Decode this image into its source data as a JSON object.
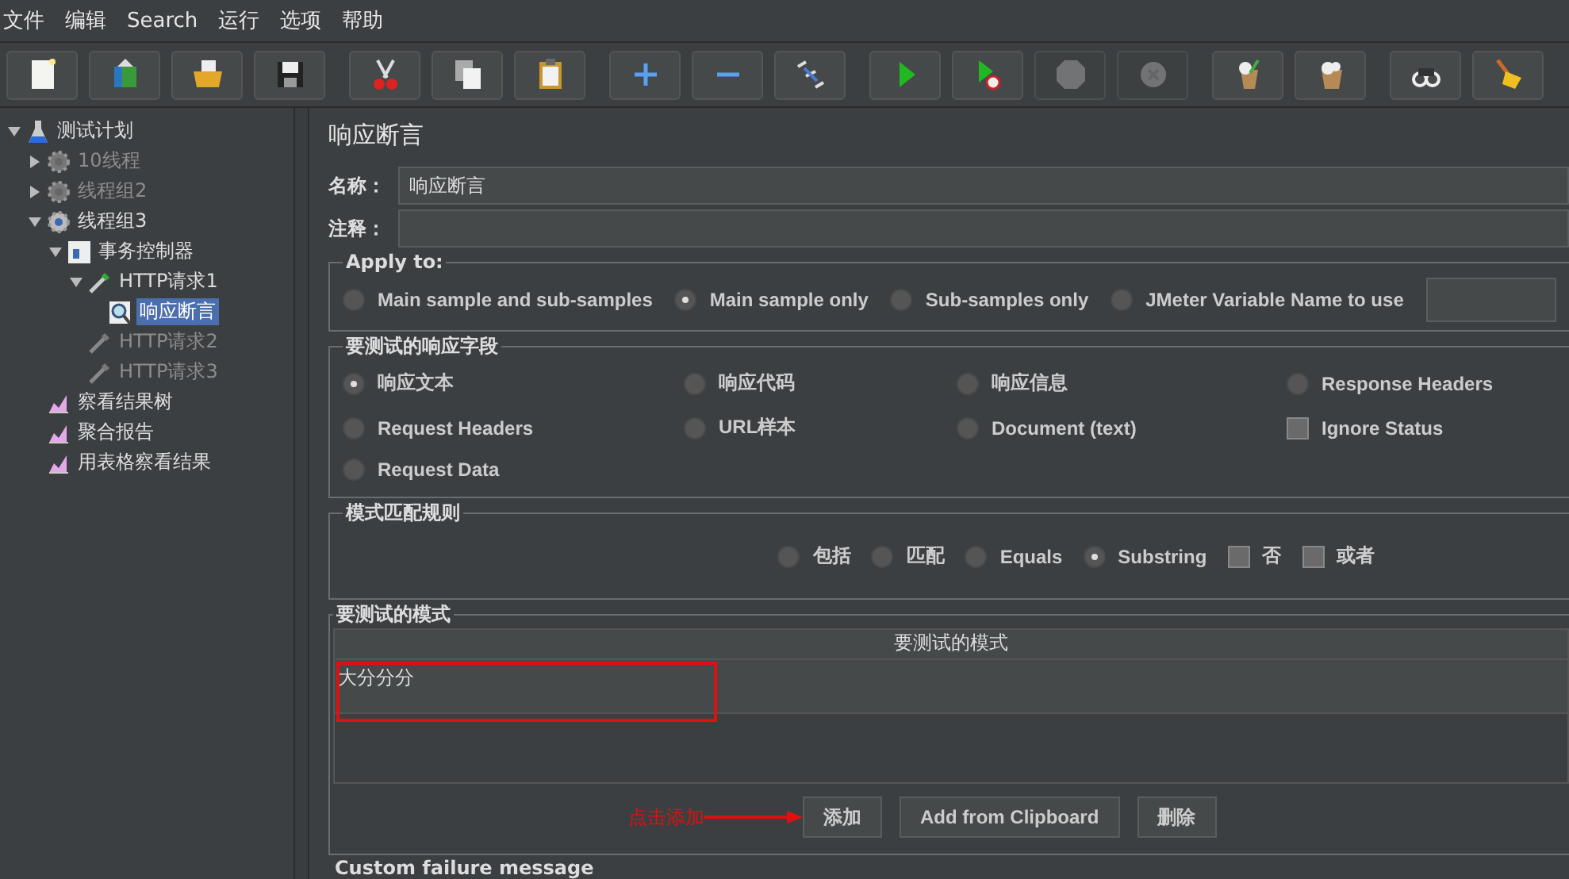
{
  "menu": [
    {
      "label": "文件"
    },
    {
      "label": "编辑"
    },
    {
      "label": "Search"
    },
    {
      "label": "运行"
    },
    {
      "label": "选项"
    },
    {
      "label": "帮助"
    }
  ],
  "toolbar": [
    {
      "disabled": false
    },
    {
      "disabled": false
    },
    {
      "disabled": false
    },
    {
      "disabled": false
    },
    {
      "disabled": false
    },
    {
      "disabled": false
    },
    {
      "disabled": false
    },
    {
      "disabled": false
    },
    {
      "disabled": false
    },
    {
      "disabled": false
    },
    {
      "disabled": false
    },
    {
      "disabled": false
    },
    {
      "disabled": true
    },
    {
      "disabled": true
    },
    {
      "disabled": false
    },
    {
      "disabled": false
    },
    {
      "disabled": false
    },
    {
      "disabled": false
    }
  ],
  "tree": [
    {
      "label": "测试计划",
      "kind": "plan",
      "expanded": true,
      "selected": false,
      "disabled": false,
      "children": [
        {
          "label": "10线程",
          "kind": "thread",
          "expanded": false,
          "selected": false,
          "disabled": true
        },
        {
          "label": "线程组2",
          "kind": "thread",
          "expanded": false,
          "selected": false,
          "disabled": true
        },
        {
          "label": "线程组3",
          "kind": "thread",
          "expanded": true,
          "selected": false,
          "disabled": false,
          "children": [
            {
              "label": "事务控制器",
              "kind": "controller",
              "expanded": true,
              "selected": false,
              "disabled": false,
              "children": [
                {
                  "label": "HTTP请求1",
                  "kind": "sampler",
                  "expanded": true,
                  "selected": false,
                  "disabled": false,
                  "children": [
                    {
                      "label": "响应断言",
                      "kind": "assertion",
                      "selected": true,
                      "disabled": false
                    }
                  ]
                },
                {
                  "label": "HTTP请求2",
                  "kind": "sampler",
                  "selected": false,
                  "disabled": true
                },
                {
                  "label": "HTTP请求3",
                  "kind": "sampler",
                  "selected": false,
                  "disabled": true
                }
              ]
            }
          ]
        },
        {
          "label": "察看结果树",
          "kind": "listener",
          "selected": false,
          "disabled": false
        },
        {
          "label": "聚合报告",
          "kind": "listener",
          "selected": false,
          "disabled": false
        },
        {
          "label": "用表格察看结果",
          "kind": "listener",
          "selected": false,
          "disabled": false
        }
      ]
    }
  ],
  "panel": {
    "title": "响应断言",
    "name_label": "名称：",
    "name_value": "响应断言",
    "comment_label": "注释："
  },
  "apply_to": {
    "title": "Apply to:",
    "options": [
      {
        "label": "Main sample and sub-samples",
        "selected": false
      },
      {
        "label": "Main sample only",
        "selected": true
      },
      {
        "label": "Sub-samples only",
        "selected": false
      },
      {
        "label": "JMeter Variable Name to use",
        "selected": false
      }
    ]
  },
  "response_field": {
    "title": "要测试的响应字段",
    "options": [
      {
        "label": "响应文本",
        "kind": "radio",
        "selected": true
      },
      {
        "label": "响应代码",
        "kind": "radio",
        "selected": false
      },
      {
        "label": "响应信息",
        "kind": "radio",
        "selected": false
      },
      {
        "label": "Response Headers",
        "kind": "radio",
        "selected": false
      },
      {
        "label": "Request Headers",
        "kind": "radio",
        "selected": false
      },
      {
        "label": "URL样本",
        "kind": "radio",
        "selected": false
      },
      {
        "label": "Document (text)",
        "kind": "radio",
        "selected": false
      },
      {
        "label": "Ignore Status",
        "kind": "checkbox",
        "checked": false
      },
      {
        "label": "Request Data",
        "kind": "radio",
        "selected": false
      }
    ]
  },
  "match_rules": {
    "title": "模式匹配规则",
    "options": [
      {
        "label": "包括",
        "kind": "radio",
        "selected": false
      },
      {
        "label": "匹配",
        "kind": "radio",
        "selected": false
      },
      {
        "label": "Equals",
        "kind": "radio",
        "selected": false
      },
      {
        "label": "Substring",
        "kind": "radio",
        "selected": true
      },
      {
        "label": "否",
        "kind": "checkbox",
        "checked": false
      },
      {
        "label": "或者",
        "kind": "checkbox",
        "checked": false
      }
    ]
  },
  "patterns": {
    "title": "要测试的模式",
    "column": "要测试的模式",
    "rows": [
      "大分分分"
    ],
    "buttons": [
      {
        "label": "添加"
      },
      {
        "label": "Add from Clipboard"
      },
      {
        "label": "删除"
      }
    ]
  },
  "annotation": {
    "text": "点击添加"
  },
  "custom_failure": {
    "title": "Custom failure message"
  }
}
